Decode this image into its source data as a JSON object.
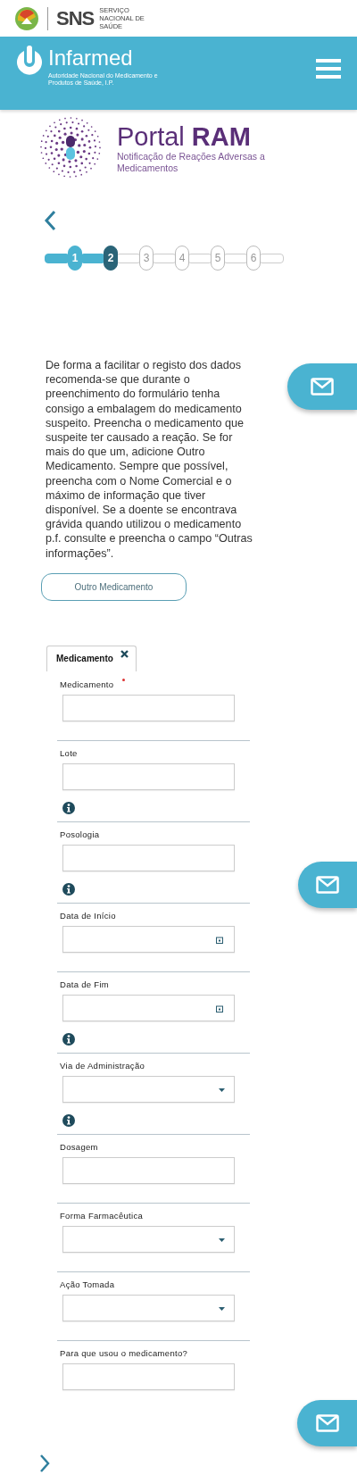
{
  "top_bar": {
    "brand": "SNS",
    "brand_subtitle": "SERVIÇO NACIONAL DE SAÚDE"
  },
  "header": {
    "brand": "Infarmed",
    "brand_subtitle": "Autoridade Nacional do Medicamento e Produtos de Saúde, I.P."
  },
  "portal": {
    "title": "Portal **RAM**",
    "subtitle": "Notificação de Reações Adversas a Medicamentos"
  },
  "steps": [
    {
      "label": "1",
      "completed": true,
      "selected": false
    },
    {
      "label": "2",
      "completed": false,
      "selected": true
    },
    {
      "label": "3",
      "completed": false,
      "selected": false
    },
    {
      "label": "4",
      "completed": false,
      "selected": false
    },
    {
      "label": "5",
      "completed": false,
      "selected": false
    },
    {
      "label": "6",
      "completed": false,
      "selected": false
    }
  ],
  "intro": "De forma a facilitar o registo dos dados recomenda-se que durante o preenchimento do formulário tenha consigo a embalagem do medicamento suspeito. Preencha o medicamento que suspeite ter causado a reação. Se for mais do que um, adicione Outro Medicamento. Sempre que possível, preencha com o Nome Comercial e o máximo de informação que tiver disponível. Se a doente se encontrava grávida quando utilizou o medicamento p.f. consulte e preencha o campo “Outras informações”.",
  "add_button": "Outro Medicamento",
  "tabs": [
    {
      "label": "Medicamento",
      "selected": true
    }
  ],
  "fields": [
    {
      "label": "Medicamento",
      "kind": "text",
      "required": true,
      "info": false
    },
    {
      "label": "Lote",
      "kind": "text",
      "required": false,
      "info": true
    },
    {
      "label": "Posologia",
      "kind": "text",
      "required": false,
      "info": true
    },
    {
      "label": "Data de Início",
      "kind": "date",
      "required": false,
      "info": false
    },
    {
      "label": "Data de Fim",
      "kind": "date",
      "required": false,
      "info": true
    },
    {
      "label": "Via de Administração",
      "kind": "select",
      "required": false,
      "info": true
    },
    {
      "label": "Dosagem",
      "kind": "text",
      "required": false,
      "info": false
    },
    {
      "label": "Forma Farmacêutica",
      "kind": "select",
      "required": false,
      "info": false
    },
    {
      "label": "Ação Tomada",
      "kind": "select",
      "required": false,
      "info": false
    },
    {
      "label": "Para que usou o medicamento?",
      "kind": "text",
      "required": false,
      "info": false
    }
  ]
}
